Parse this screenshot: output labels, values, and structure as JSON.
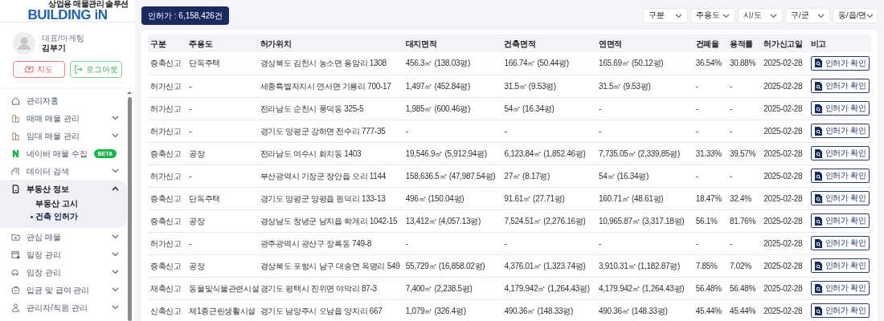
{
  "logo": {
    "tagline": "상업용 매물관리 솔루션",
    "wordmark": "BUILDING iN"
  },
  "profile": {
    "role": "대표/마케팅",
    "name": "김부기"
  },
  "profile_buttons": [
    {
      "kind": "map",
      "label": "지도"
    },
    {
      "kind": "logout",
      "label": "로그아웃"
    }
  ],
  "sidebar": {
    "items": [
      {
        "kind": "home",
        "label": "관리자홈"
      },
      {
        "kind": "building",
        "label": "매매 매물 관리",
        "expanded": false
      },
      {
        "kind": "building",
        "label": "임대 매물 관리",
        "expanded": false
      },
      {
        "kind": "naver",
        "label": "네이버 매물 수집",
        "badge": "BETA"
      },
      {
        "kind": "chart",
        "label": "데이터 검색",
        "expanded": false
      },
      {
        "kind": "doc",
        "label": "부동산 정보",
        "expanded": true,
        "children": [
          {
            "label": "부동산 고시",
            "selected": false
          },
          {
            "label": "건축 인허가",
            "selected": true
          }
        ]
      },
      {
        "kind": "folder",
        "label": "관심 매물",
        "expanded": false
      },
      {
        "kind": "calendar",
        "label": "일정 관리",
        "expanded": false
      },
      {
        "kind": "car",
        "label": "임장 관리",
        "expanded": false
      },
      {
        "kind": "money",
        "label": "입금 및 급여 관리",
        "expanded": false
      },
      {
        "kind": "person",
        "label": "관리자/직원 관리",
        "expanded": false
      }
    ]
  },
  "count_badge": "인허가 : 6,158,426건",
  "filters": [
    "구분",
    "주용도",
    "시/도",
    "구/군",
    "동/읍/면"
  ],
  "table": {
    "columns": [
      "구분",
      "주용도",
      "허가위치",
      "대지면적",
      "건축면적",
      "연면적",
      "건폐율",
      "용적률",
      "허가신고일",
      "비고"
    ],
    "rows": [
      [
        "증축신고",
        "단독주택",
        "경상북도 김천시 농소면 용암리 1308",
        "456.3㎡ (138.03평)",
        "166.74㎡ (50.44평)",
        "165.69㎡ (50.12평)",
        "36.54%",
        "30.88%",
        "2025-02-28",
        "인허가 확인"
      ],
      [
        "허가신고",
        "-",
        "세종특별자치시 연서면 기룡리 700-17",
        "1,497㎡ (452.84평)",
        "31.5㎡ (9.53평)",
        "31.5㎡ (9.53평)",
        "-",
        "-",
        "2025-02-28",
        "인허가 확인"
      ],
      [
        "허가신고",
        "-",
        "전라남도 순천시 풍덕동 325-5",
        "1,985㎡ (600.46평)",
        "54㎡ (16.34평)",
        "-",
        "-",
        "-",
        "2025-02-28",
        "인허가 확인"
      ],
      [
        "허가신고",
        "-",
        "경기도 양평군 강하면 전수리 777-35",
        "-",
        "-",
        "-",
        "-",
        "-",
        "2025-02-28",
        "인허가 확인"
      ],
      [
        "증축신고",
        "공장",
        "전라남도 여수시 화치동 1403",
        "19,546.9㎡ (5,912.94평)",
        "6,123.84㎡ (1,852.46평)",
        "7,735.05㎡ (2,339.85평)",
        "31.33%",
        "39.57%",
        "2025-02-28",
        "인허가 확인"
      ],
      [
        "허가신고",
        "-",
        "부산광역시 기장군 장안읍 오리 1144",
        "158,636.5㎡ (47,987.54평)",
        "27㎡ (8.17평)",
        "54㎡ (16.34평)",
        "-",
        "-",
        "2025-02-28",
        "인허가 확인"
      ],
      [
        "증축신고",
        "단독주택",
        "경기도 양평군 양평읍 원덕리 133-13",
        "496㎡ (150.04평)",
        "91.61㎡ (27.71평)",
        "160.71㎡ (48.61평)",
        "18.47%",
        "32.4%",
        "2025-02-28",
        "인허가 확인"
      ],
      [
        "증축신고",
        "공장",
        "경상남도 창녕군 남지읍 학계리 1042-15",
        "13,412㎡ (4,057.13평)",
        "7,524.51㎡ (2,276.16평)",
        "10,965.87㎡ (3,317.18평)",
        "56.1%",
        "81.76%",
        "2025-02-28",
        "인허가 확인"
      ],
      [
        "허가신고",
        "-",
        "광주광역시 광산구 장록동 749-8",
        "-",
        "-",
        "-",
        "-",
        "-",
        "2025-02-28",
        "인허가 확인"
      ],
      [
        "증축신고",
        "공장",
        "경상북도 포항시 남구 대송면 옥명리 549",
        "55,729㎡ (16,858.02평)",
        "4,376.01㎡ (1,323.74평)",
        "3,910.31㎡ (1,182.87평)",
        "7.85%",
        "7.02%",
        "2025-02-28",
        "인허가 확인"
      ],
      [
        "재축신고",
        "동물및식물관련시설",
        "경기도 평택시 진위면 야막리 87-3",
        "7,400㎡ (2,238.5평)",
        "4,179.942㎡ (1,264.43평)",
        "4,179.942㎡ (1,264.43평)",
        "56.48%",
        "56.48%",
        "2025-02-28",
        "인허가 확인"
      ],
      [
        "신축신고",
        "제1종근린생활시설",
        "경기도 남양주시 오남읍 양지리 667",
        "1,079㎡ (326.4평)",
        "490.36㎡ (148.33평)",
        "490.36㎡ (148.33평)",
        "45.44%",
        "45.44%",
        "2025-02-28",
        "인허가 확인"
      ]
    ]
  }
}
